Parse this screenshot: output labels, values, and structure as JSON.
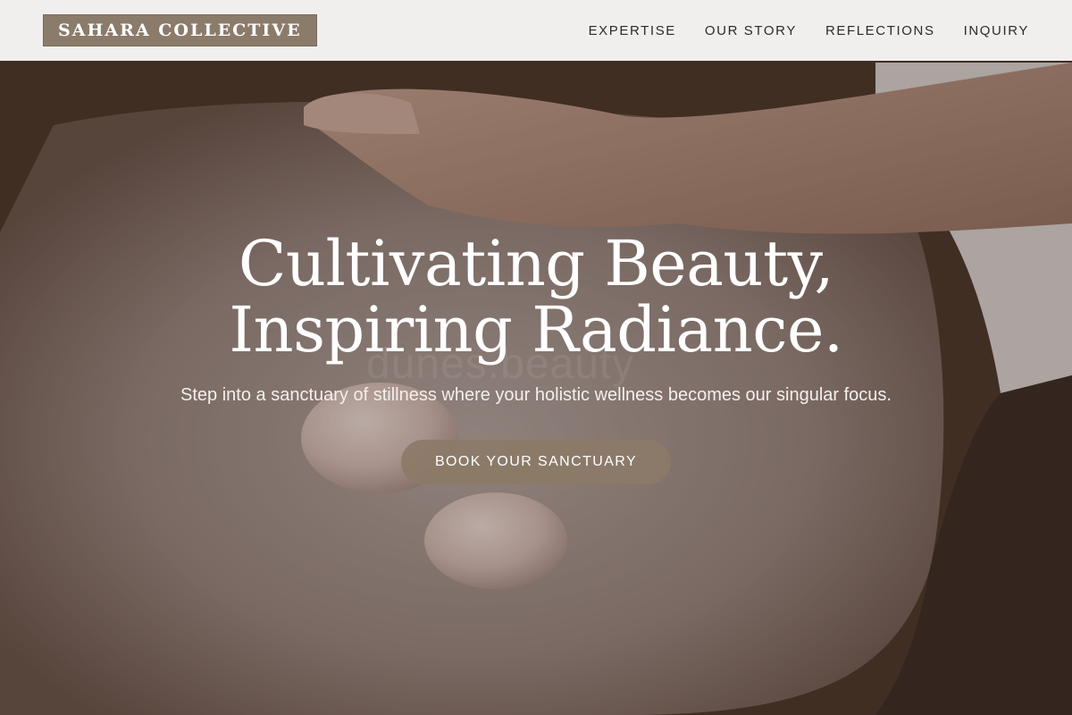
{
  "header": {
    "brand": "SAHARA COLLECTIVE",
    "nav": [
      {
        "label": "EXPERTISE"
      },
      {
        "label": "OUR STORY"
      },
      {
        "label": "REFLECTIONS"
      },
      {
        "label": "INQUIRY"
      }
    ]
  },
  "hero": {
    "headline_line1": "Cultivating Beauty,",
    "headline_line2": "Inspiring Radiance.",
    "subtext": "Step into a sanctuary of stillness where your holistic wellness becomes our singular focus.",
    "cta_label": "BOOK YOUR SANCTUARY",
    "watermark": "dunes.beauty",
    "image": "massage-hands-rose-quartz-stones"
  },
  "colors": {
    "brand_bg": "#8b7b6a",
    "cta_bg": "#8c7a68",
    "header_bg": "#f7f6f5",
    "headline": "#ffffff"
  }
}
